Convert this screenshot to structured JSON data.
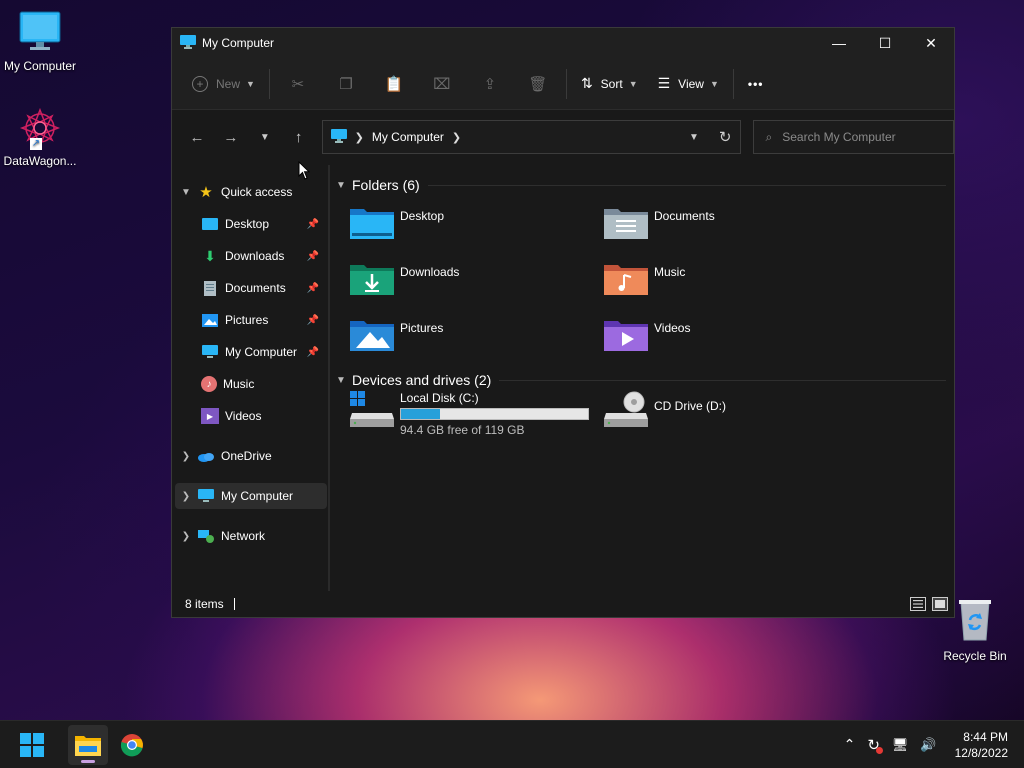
{
  "desktop": {
    "icons": [
      {
        "label": "My Computer",
        "icon": "monitor-icon"
      },
      {
        "label": "DataWagon...",
        "icon": "datawagon-icon"
      },
      {
        "label": "Recycle Bin",
        "icon": "recycle-bin-icon"
      }
    ]
  },
  "window": {
    "title": "My Computer",
    "controls": {
      "minimize": "—",
      "maximize": "☐",
      "close": "✕"
    }
  },
  "toolbar": {
    "new_label": "New",
    "sort_label": "Sort",
    "view_label": "View",
    "more_label": "•••"
  },
  "address": {
    "location": "My Computer",
    "search_placeholder": "Search My Computer"
  },
  "nav": {
    "quick_access": "Quick access",
    "quick_items": [
      {
        "label": "Desktop",
        "icon": "desktop-folder-icon"
      },
      {
        "label": "Downloads",
        "icon": "download-icon"
      },
      {
        "label": "Documents",
        "icon": "documents-icon"
      },
      {
        "label": "Pictures",
        "icon": "pictures-icon"
      },
      {
        "label": "My Computer",
        "icon": "monitor-icon"
      },
      {
        "label": "Music",
        "icon": "music-icon"
      },
      {
        "label": "Videos",
        "icon": "videos-icon"
      }
    ],
    "onedrive": "OneDrive",
    "mycomputer": "My Computer",
    "network": "Network"
  },
  "content": {
    "folders_heading": "Folders (6)",
    "folders": [
      {
        "label": "Desktop",
        "color": "#1e90d6"
      },
      {
        "label": "Documents",
        "color": "#8a9aae"
      },
      {
        "label": "Downloads",
        "color": "#1aa37a"
      },
      {
        "label": "Music",
        "color": "#e0704a"
      },
      {
        "label": "Pictures",
        "color": "#2a8ad8"
      },
      {
        "label": "Videos",
        "color": "#8a4ad0"
      }
    ],
    "drives_heading": "Devices and drives (2)",
    "drives": [
      {
        "label": "Local Disk (C:)",
        "free_text": "94.4 GB free of 119 GB",
        "used_fraction": 0.207
      },
      {
        "label": "CD Drive (D:)"
      }
    ]
  },
  "status": {
    "items": "8 items"
  },
  "taskbar": {
    "time": "8:44 PM",
    "date": "12/8/2022"
  },
  "colors": {
    "accent": "#26a0da",
    "window_bg": "#191919",
    "taskbar_bg": "#1c1c1c"
  }
}
